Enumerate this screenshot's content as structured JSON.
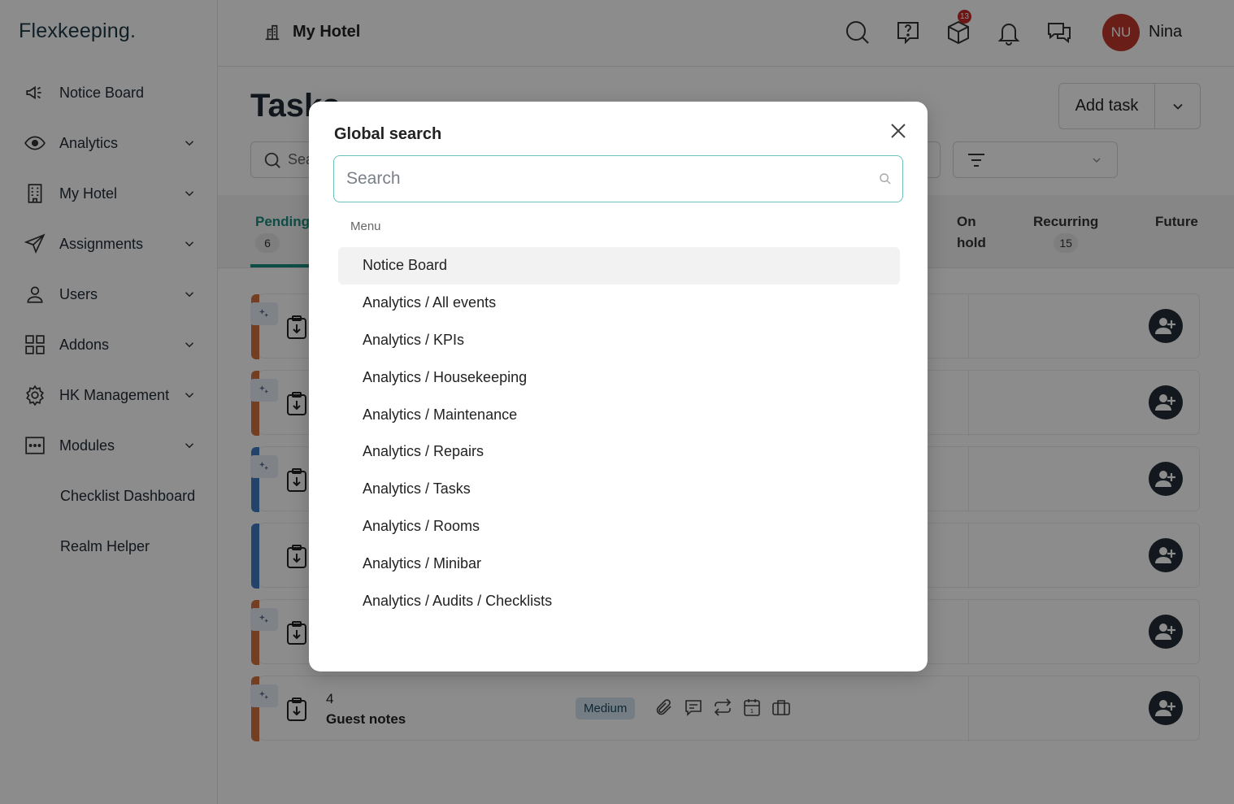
{
  "app": {
    "logo": "Flexkeeping.",
    "hotel_name": "My Hotel",
    "user_initials": "NU",
    "user_name": "Nina",
    "notification_badge": "13",
    "accent_color": "#1a8c7e"
  },
  "sidebar": {
    "items": [
      {
        "label": "Notice Board",
        "icon": "megaphone-icon"
      },
      {
        "label": "Analytics",
        "icon": "eye-icon"
      },
      {
        "label": "My Hotel",
        "icon": "building-icon"
      },
      {
        "label": "Assignments",
        "icon": "send-icon"
      },
      {
        "label": "Users",
        "icon": "user-icon"
      },
      {
        "label": "Addons",
        "icon": "grid-icon"
      },
      {
        "label": "HK Management",
        "icon": "gear-icon"
      },
      {
        "label": "Modules",
        "icon": "dots-icon"
      },
      {
        "label": "Checklist Dashboard"
      },
      {
        "label": "Realm Helper"
      }
    ]
  },
  "main": {
    "title": "Tasks",
    "add_task_label": "Add task",
    "search_placeholder": "Sea",
    "tabs": [
      {
        "label": "Pending",
        "count": "6"
      },
      {
        "label": "On hold",
        "count": ""
      },
      {
        "label": "Recurring",
        "count": "15"
      },
      {
        "label": "Future",
        "count": ""
      }
    ],
    "last_row": {
      "number": "4",
      "name": "Guest notes",
      "priority": "Medium"
    }
  },
  "modal": {
    "title": "Global search",
    "search_placeholder": "Search",
    "section_label": "Menu",
    "results": [
      "Notice Board",
      "Analytics / All events",
      "Analytics / KPIs",
      "Analytics / Housekeeping",
      "Analytics / Maintenance",
      "Analytics / Repairs",
      "Analytics / Tasks",
      "Analytics / Rooms",
      "Analytics / Minibar",
      "Analytics / Audits / Checklists"
    ]
  }
}
